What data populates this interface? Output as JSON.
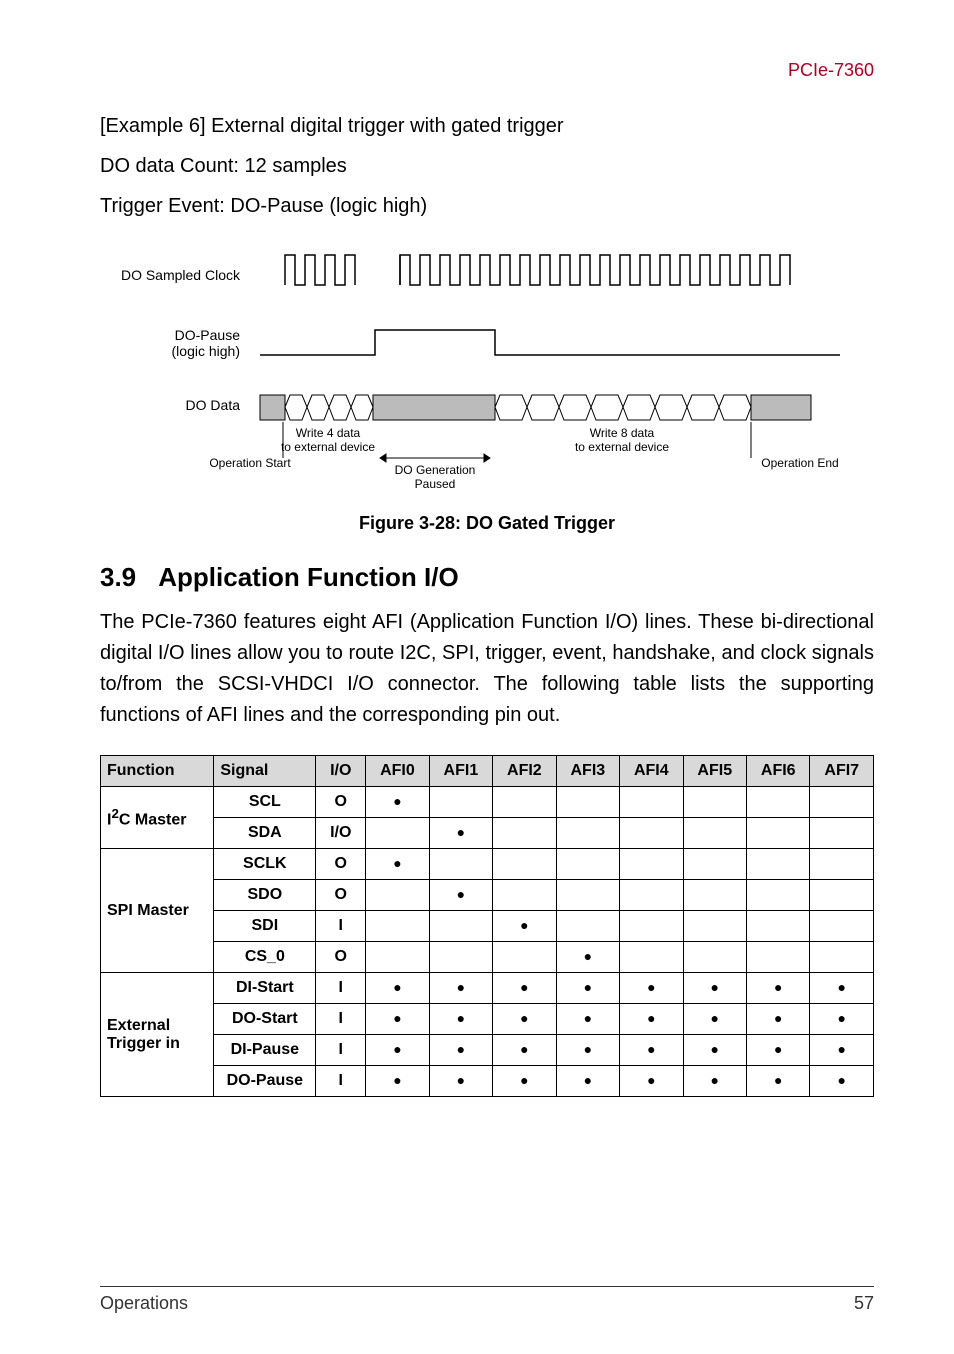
{
  "header": {
    "product": "PCIe-7360"
  },
  "intro": {
    "ex_line": "[Example 6] External digital trigger with gated trigger",
    "count_line": "DO data Count: 12 samples",
    "trig_line": "Trigger Event: DO-Pause (logic high)"
  },
  "figure": {
    "caption": "Figure 3-28: DO Gated Trigger",
    "labels": {
      "clk": "DO Sampled Clock",
      "pause": "DO-Pause",
      "pause_sub": "(logic high)",
      "data": "DO Data",
      "write4": "Write 4 data",
      "write4b": "to external device",
      "write8": "Write 8 data",
      "write8b": "to external device",
      "opstart": "Operation Start",
      "opend": "Operation End",
      "paused": "DO Generation",
      "paused2": "Paused"
    }
  },
  "section": {
    "num": "3.9",
    "title": "Application Function I/O"
  },
  "paragraph": "The PCIe-7360 features eight AFI (Application Function I/O) lines. These bi-directional digital I/O lines allow you to route I2C, SPI, trigger, event, handshake, and clock signals to/from the SCSI-VHDCI I/O connector. The following table lists the supporting functions of AFI lines and the corresponding pin out.",
  "table": {
    "headers": [
      "Function",
      "Signal",
      "I/O",
      "AFI0",
      "AFI1",
      "AFI2",
      "AFI3",
      "AFI4",
      "AFI5",
      "AFI6",
      "AFI7"
    ],
    "groups": [
      {
        "func": "I²C Master",
        "rows": [
          {
            "signal": "SCL",
            "io": "O",
            "afi": [
              1,
              0,
              0,
              0,
              0,
              0,
              0,
              0
            ]
          },
          {
            "signal": "SDA",
            "io": "I/O",
            "afi": [
              0,
              1,
              0,
              0,
              0,
              0,
              0,
              0
            ]
          }
        ]
      },
      {
        "func": "SPI Master",
        "rows": [
          {
            "signal": "SCLK",
            "io": "O",
            "afi": [
              1,
              0,
              0,
              0,
              0,
              0,
              0,
              0
            ]
          },
          {
            "signal": "SDO",
            "io": "O",
            "afi": [
              0,
              1,
              0,
              0,
              0,
              0,
              0,
              0
            ]
          },
          {
            "signal": "SDI",
            "io": "I",
            "afi": [
              0,
              0,
              1,
              0,
              0,
              0,
              0,
              0
            ]
          },
          {
            "signal": "CS_0",
            "io": "O",
            "afi": [
              0,
              0,
              0,
              1,
              0,
              0,
              0,
              0
            ]
          }
        ]
      },
      {
        "func": "External Trigger in",
        "rows": [
          {
            "signal": "DI-Start",
            "io": "I",
            "afi": [
              1,
              1,
              1,
              1,
              1,
              1,
              1,
              1
            ]
          },
          {
            "signal": "DO-Start",
            "io": "I",
            "afi": [
              1,
              1,
              1,
              1,
              1,
              1,
              1,
              1
            ]
          },
          {
            "signal": "DI-Pause",
            "io": "I",
            "afi": [
              1,
              1,
              1,
              1,
              1,
              1,
              1,
              1
            ]
          },
          {
            "signal": "DO-Pause",
            "io": "I",
            "afi": [
              1,
              1,
              1,
              1,
              1,
              1,
              1,
              1
            ]
          }
        ]
      }
    ]
  },
  "footer": {
    "left": "Operations",
    "right": "57"
  }
}
